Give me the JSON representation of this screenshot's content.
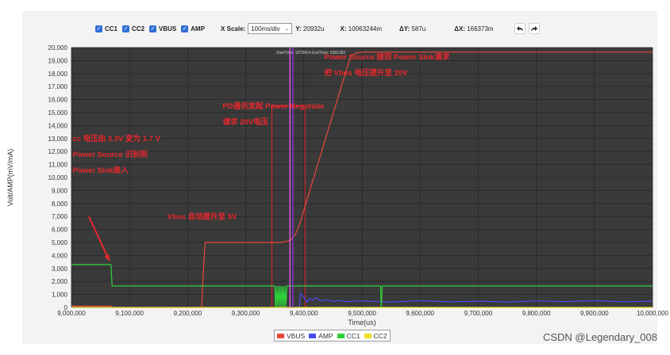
{
  "toolbar": {
    "checkboxes": [
      "CC1",
      "CC2",
      "VBUS",
      "AMP"
    ],
    "xscale_label": "X Scale:",
    "xscale_value": "100ms/div",
    "y_label": "Y:",
    "y_value": "20932u",
    "x_label": "X:",
    "x_value": "10063244m",
    "dy_label": "ΔY:",
    "dy_value": "587u",
    "dx_label": "ΔX:",
    "dx_value": "166373m",
    "undo_icon": "undo-icon",
    "redo_icon": "redo-icon"
  },
  "plot_header": "StartTime: 9379824 EndTime: 9381082",
  "watermark": "CSDN @Legendary_008",
  "chart_data": {
    "type": "line",
    "xlabel": "Time(us)",
    "ylabel": "Volt/AMP(mV/mA)",
    "xlim": [
      9000000,
      10000000
    ],
    "ylim": [
      0,
      20000
    ],
    "xticks": [
      "9,000,000",
      "9,100,000",
      "9,200,000",
      "9,300,000",
      "9,400,000",
      "9,500,000",
      "9,600,000",
      "9,700,000",
      "9,800,000",
      "9,900,000",
      "10,000,000"
    ],
    "yticks": [
      "0",
      "1,000",
      "2,000",
      "3,000",
      "4,000",
      "5,000",
      "6,000",
      "7,000",
      "8,000",
      "9,000",
      "10,000",
      "11,000",
      "12,000",
      "13,000",
      "14,000",
      "15,000",
      "16,000",
      "17,000",
      "18,000",
      "19,000",
      "20,000"
    ],
    "grid": true,
    "background": "#3a3a3a",
    "legend_position": "bottom",
    "series": [
      {
        "name": "VBUS",
        "color": "#e8483d",
        "x": [
          9000000,
          9067000,
          9070000,
          9224000,
          9226000,
          9230000,
          9360000,
          9368000,
          9376000,
          9385000,
          9392000,
          9480000,
          9490000,
          9505000,
          10000000
        ],
        "y": [
          100,
          100,
          0,
          0,
          1900,
          5000,
          5000,
          5050,
          5150,
          5600,
          6300,
          19300,
          19600,
          19650,
          19650
        ]
      },
      {
        "name": "AMP",
        "color": "#4a4aee",
        "x": [
          9000000,
          9392000,
          9394000,
          9400000,
          9405000,
          9410000,
          9415000,
          9420000,
          9430000,
          9440000,
          9450000,
          9460000,
          9470000,
          9500000,
          9550000,
          9600000,
          9650000,
          9700000,
          9750000,
          9800000,
          9850000,
          9900000,
          9950000,
          10000000
        ],
        "y": [
          0,
          0,
          1100,
          800,
          400,
          700,
          550,
          750,
          500,
          600,
          450,
          550,
          450,
          500,
          420,
          520,
          430,
          480,
          420,
          500,
          450,
          520,
          440,
          480
        ]
      },
      {
        "name": "CC1",
        "color": "#2ed13a",
        "x": [
          9000000,
          9068000,
          9070000,
          9350000,
          9351000,
          9353000,
          9354000,
          9356000,
          9357000,
          9359000,
          9360000,
          9362000,
          9363000,
          9365000,
          9366000,
          9368000,
          9369000,
          9371000,
          9372000,
          9532000,
          9533000,
          9535000,
          9536000,
          10000000
        ],
        "y": [
          3300,
          3300,
          1650,
          1650,
          0,
          1650,
          0,
          1650,
          0,
          1650,
          0,
          1650,
          0,
          1650,
          0,
          1650,
          0,
          1650,
          1650,
          1650,
          0,
          1650,
          1650,
          1650
        ]
      },
      {
        "name": "CC2",
        "color": "#f0e020",
        "x": [
          9000000,
          10000000
        ],
        "y": [
          0,
          0
        ]
      }
    ],
    "markers": [
      {
        "name": "cursor-a",
        "x": 9376000,
        "color": "#ff66ff"
      },
      {
        "name": "cursor-b",
        "x": 9381000,
        "color": "#9b30ff"
      }
    ],
    "annotation_boxes": [
      {
        "name": "pd-negotiation-box",
        "x": [
          9345000,
          9402000
        ],
        "y": [
          0,
          15500
        ]
      }
    ],
    "annotations": [
      {
        "name": "annotation-cc-change",
        "lines": [
          "cc 电压由 3.3V 变为 1.7 V",
          "Power Source 识别到",
          "Power Sink接入"
        ],
        "x": 9002000,
        "y": 12800
      },
      {
        "name": "annotation-vbus-5v",
        "lines": [
          "Vbus 自动提升至 5V"
        ],
        "x": 9165000,
        "y": 6800
      },
      {
        "name": "annotation-pd-negotiate",
        "lines": [
          "PD通讯发起 Power Negotiate",
          "请求 20V电压"
        ],
        "x": 9260000,
        "y": 15300
      },
      {
        "name": "annotation-vbus-20v",
        "lines": [
          "Power Source 接到 Power Sink请求",
          "把 Vbus 电压提升至 20V"
        ],
        "x": 9435000,
        "y": 19100
      }
    ],
    "arrow": {
      "from": [
        9030000,
        7000
      ],
      "to": [
        9065000,
        3600
      ]
    }
  }
}
